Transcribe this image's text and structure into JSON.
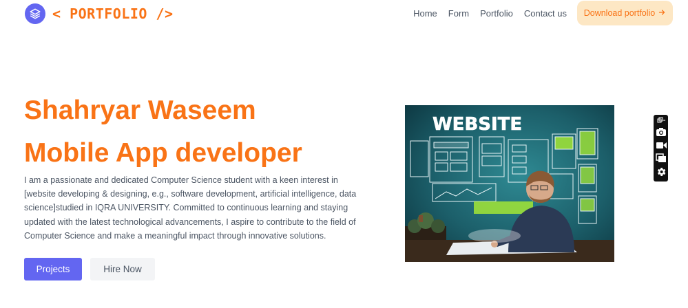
{
  "header": {
    "logo_text": "< PORTFOLIO />",
    "logo_icon": "layers-icon",
    "nav": [
      "Home",
      "Form",
      "Portfolio",
      "Contact us"
    ],
    "download_label": "Download portfolio",
    "download_icon": "arrow-right-icon"
  },
  "hero": {
    "name": "Shahryar Waseem",
    "role": "Mobile App developer",
    "description": "I am a passionate and dedicated Computer Science student with a keen interest in [website developing & designing, e.g., software development, artificial intelligence, data science]studied in IQRA UNIVERSITY. Committed to continuous learning and staying updated with the latest technological advancements, I aspire to contribute to the field of Computer Science and make a meaningful impact through innovative solutions.",
    "primary_button": "Projects",
    "secondary_button": "Hire Now",
    "image_text": "WEBSITE"
  },
  "side_toolbar": {
    "tools": [
      "popout-icon",
      "camera-icon",
      "video-camera-icon",
      "copy-icon",
      "gear-icon"
    ]
  },
  "colors": {
    "accent_orange": "#f97316",
    "primary_indigo": "#6366f1",
    "download_bg": "#fde7c4",
    "body_text": "#4b5563"
  }
}
